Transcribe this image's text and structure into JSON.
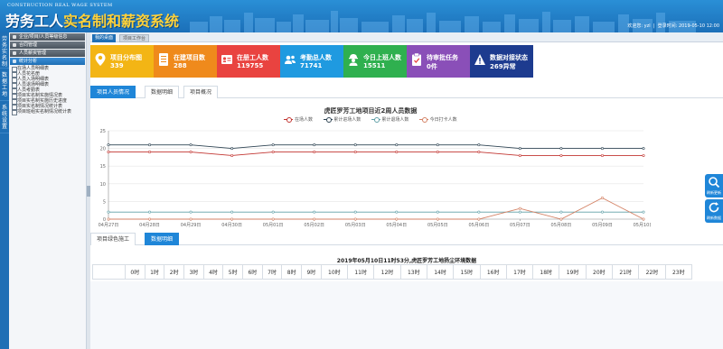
{
  "header": {
    "subtitle": "CONSTRUCTION REAL WAGE SYSTEM",
    "title_main": "劳务工人",
    "title_accent": "实名制和薪资系统",
    "welcome_label": "欢迎您",
    "user": "yzl",
    "login_time_label": "登录时间",
    "login_time": "2019-05-10 12:00"
  },
  "left_strip": [
    "劳务实名制",
    "数据工地",
    "系统设置"
  ],
  "sidebar": {
    "groups": [
      {
        "label": "企业/项目/人员等级信息",
        "active": false
      },
      {
        "label": "合同管理",
        "active": false
      },
      {
        "label": "人员薪资管理",
        "active": false
      },
      {
        "label": "统计分析",
        "active": true
      }
    ],
    "items": [
      "在场人员明细表",
      "人员花名册",
      "人员入场明细表",
      "人员退场明细表",
      "人员考勤表",
      "项目实名制实施情况表",
      "项目实名制实施历史进度",
      "项目实名制情况统计表",
      "项目班组实名制情况统计表"
    ]
  },
  "page_tabs": [
    "我的桌面",
    "项目工作台"
  ],
  "cards": [
    {
      "label": "项目分布图",
      "value": "339",
      "color": "#f3b515",
      "icon": "map-pin-icon"
    },
    {
      "label": "在建项目数",
      "value": "288",
      "color": "#ef8a1c",
      "icon": "document-icon"
    },
    {
      "label": "在册工人数",
      "value": "119755",
      "color": "#e94340",
      "icon": "id-card-icon"
    },
    {
      "label": "考勤总人数",
      "value": "71741",
      "color": "#1f9ae0",
      "icon": "users-icon"
    },
    {
      "label": "今日上班人数",
      "value": "15511",
      "color": "#2fb04f",
      "icon": "worker-icon"
    },
    {
      "label": "待审批任务",
      "value": "0件",
      "color": "#8a4fb8",
      "icon": "clipboard-icon"
    },
    {
      "label": "数据对接状态",
      "value": "269异常",
      "color": "#1d3b8f",
      "icon": "warning-icon"
    }
  ],
  "section_tabs": [
    "项目人员情况",
    "数据明细",
    "项目概况"
  ],
  "chart_data": {
    "type": "line",
    "title": "虎匠罗芳工地项目近2周人员数据",
    "categories": [
      "04月27日",
      "04月28日",
      "04月29日",
      "04月30日",
      "05月01日",
      "05月02日",
      "05月03日",
      "05月04日",
      "05月05日",
      "05月06日",
      "05月07日",
      "05月08日",
      "05月09日",
      "05月10日"
    ],
    "ylim": [
      0,
      25
    ],
    "yticks": [
      0,
      5,
      10,
      15,
      20,
      25
    ],
    "grid": true,
    "legend_position": "top",
    "series": [
      {
        "name": "在场人数",
        "color": "#c23531",
        "values": [
          19,
          19,
          19,
          18,
          19,
          19,
          19,
          19,
          19,
          19,
          18,
          18,
          18,
          18
        ]
      },
      {
        "name": "累计进场人数",
        "color": "#2f4554",
        "values": [
          21,
          21,
          21,
          20,
          21,
          21,
          21,
          21,
          21,
          21,
          20,
          20,
          20,
          20
        ]
      },
      {
        "name": "累计退场人数",
        "color": "#61a0a8",
        "values": [
          2,
          2,
          2,
          2,
          2,
          2,
          2,
          2,
          2,
          2,
          2,
          2,
          2,
          2
        ]
      },
      {
        "name": "今日打卡人数",
        "color": "#d48265",
        "values": [
          0,
          0,
          0,
          0,
          0,
          0,
          0,
          0,
          0,
          0,
          3,
          0,
          6,
          0
        ]
      }
    ]
  },
  "bottom_tabs": [
    "项目绿色施工",
    "数据明细"
  ],
  "env": {
    "title": "2019年05月10日11时53分,虎匠罗芳工地扬尘环境数据",
    "hours": [
      "0时",
      "1时",
      "2时",
      "3时",
      "4时",
      "5时",
      "6时",
      "7时",
      "8时",
      "9时",
      "10时",
      "11时",
      "12时",
      "13时",
      "14时",
      "15时",
      "16时",
      "17时",
      "18时",
      "19时",
      "20时",
      "21时",
      "22时",
      "23时"
    ]
  },
  "side_buttons": [
    {
      "label": "刷新更新",
      "icon": "search-icon"
    },
    {
      "label": "刷新数据",
      "icon": "refresh-icon"
    }
  ]
}
